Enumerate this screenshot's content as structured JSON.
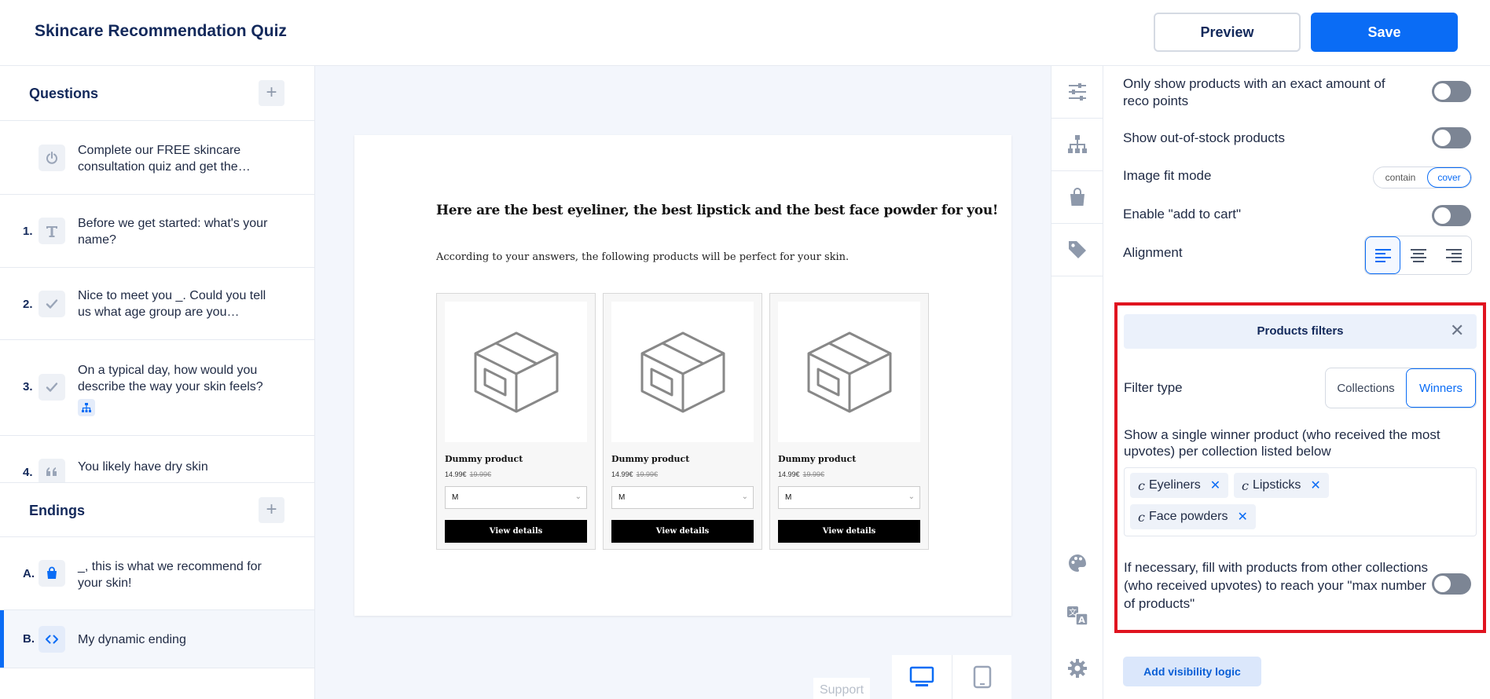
{
  "header": {
    "title": "Skincare Recommendation Quiz",
    "preview_label": "Preview",
    "save_label": "Save"
  },
  "sidebar": {
    "questions_label": "Questions",
    "intro_text": "Complete our FREE skincare consultation quiz and get the…",
    "questions": [
      {
        "num": "1.",
        "text": "Before we get started: what's your name?",
        "icon": "text-icon"
      },
      {
        "num": "2.",
        "text": "Nice to meet you _. Could you tell us what age group are you…",
        "icon": "check-icon"
      },
      {
        "num": "3.",
        "text": "On a typical day, how would you describe the way your skin feels?",
        "icon": "check-icon"
      },
      {
        "num": "4.",
        "text": "You likely have dry skin",
        "icon": "quote-icon"
      }
    ],
    "endings_label": "Endings",
    "endings": [
      {
        "num": "A.",
        "text": "_, this is what we recommend for your skin!",
        "icon": "shopping-bag-icon"
      },
      {
        "num": "B.",
        "text": "My dynamic ending",
        "icon": "code-icon"
      }
    ]
  },
  "preview": {
    "title": "Here are the best eyeliner, the best lipstick and the best face powder for you!",
    "subtitle": "According to your answers, the following products will be perfect for your skin.",
    "products": [
      {
        "name": "Dummy product",
        "price": "14.99€",
        "old_price": "19.99€",
        "size": "M",
        "button": "View details"
      },
      {
        "name": "Dummy product",
        "price": "14.99€",
        "old_price": "19.99€",
        "size": "M",
        "button": "View details"
      },
      {
        "name": "Dummy product",
        "price": "14.99€",
        "old_price": "19.99€",
        "size": "M",
        "button": "View details"
      }
    ],
    "support_label": "Support"
  },
  "settings": {
    "exact_points_label": "Only show products with an exact amount of reco points",
    "exact_points_on": false,
    "out_of_stock_label": "Show out-of-stock products",
    "out_of_stock_on": false,
    "image_fit_label": "Image fit mode",
    "image_fit_options": [
      "contain",
      "cover"
    ],
    "image_fit_selected": "cover",
    "add_to_cart_label": "Enable \"add to cart\"",
    "add_to_cart_on": false,
    "alignment_label": "Alignment",
    "alignment_selected": "left"
  },
  "filters": {
    "title": "Products filters",
    "filter_type_label": "Filter type",
    "filter_type_options": [
      "Collections",
      "Winners"
    ],
    "filter_type_selected": "Winners",
    "winner_description": "Show a single winner product (who received the most upvotes) per collection listed below",
    "collection_prefix": "c",
    "collections": [
      "Eyeliners",
      "Lipsticks",
      "Face powders"
    ],
    "fill_description": "If necessary, fill with products from other collections (who received upvotes) to reach your \"max number of products\"",
    "fill_on": false
  },
  "visibility_button": "Add visibility logic",
  "colors": {
    "accent": "#0a6cf5",
    "highlight": "#e0131f",
    "navy": "#13295b",
    "toggle_off": "#7c8594"
  }
}
